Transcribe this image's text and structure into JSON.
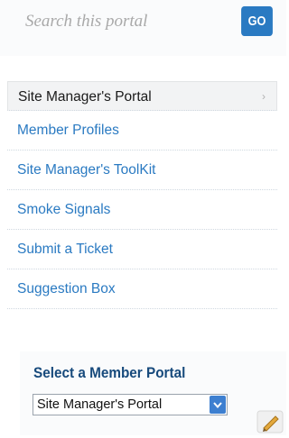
{
  "search": {
    "placeholder": "Search this portal",
    "button_label": "GO"
  },
  "nav": {
    "items": [
      {
        "label": "Site Manager's Portal",
        "active": true,
        "chevron": "›"
      },
      {
        "label": "Member Profiles"
      },
      {
        "label": "Site Manager's ToolKit"
      },
      {
        "label": "Smoke Signals"
      },
      {
        "label": "Submit a Ticket"
      },
      {
        "label": "Suggestion Box"
      }
    ]
  },
  "portal_select": {
    "title": "Select a Member Portal",
    "selected": "Site Manager's Portal",
    "edit_icon": "pencil-icon"
  },
  "colors": {
    "accent": "#2a7ac2",
    "title": "#174a7c",
    "active_bg": "#f2f3f4"
  }
}
